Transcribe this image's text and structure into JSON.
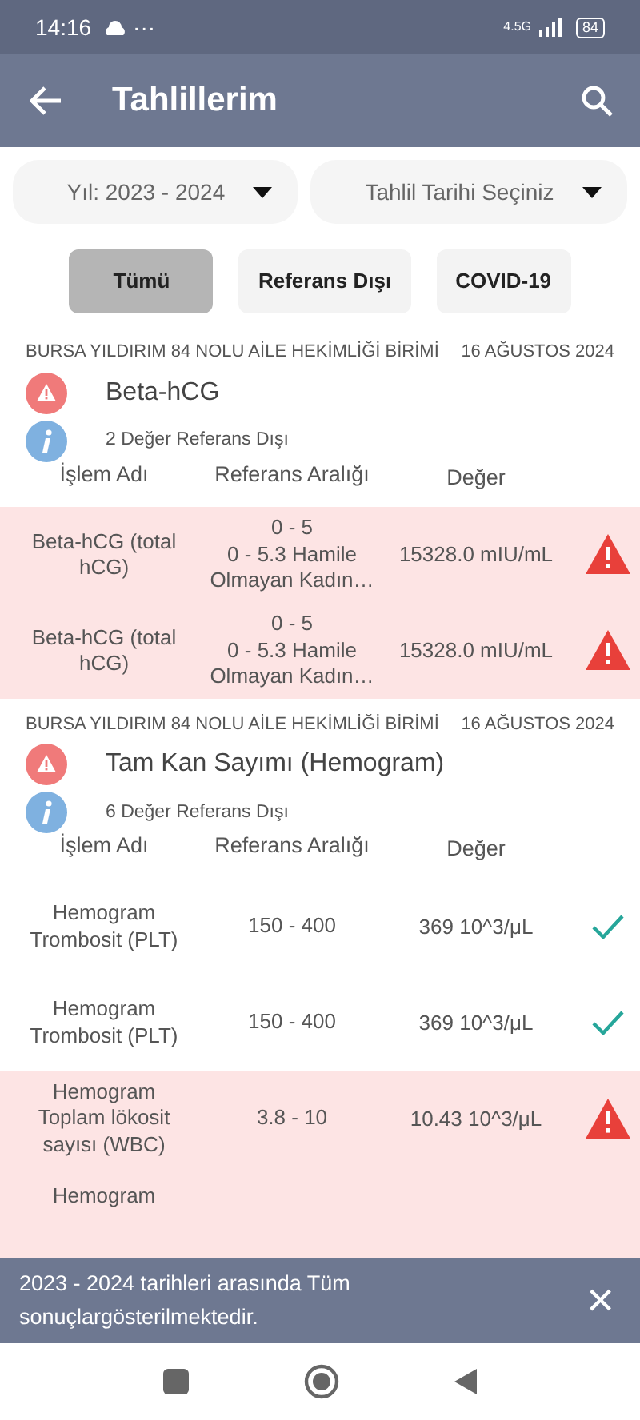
{
  "status_bar": {
    "time": "14:16",
    "dots": "···",
    "network": "4.5G",
    "battery": "84"
  },
  "app_bar": {
    "title": "Tahlillerim"
  },
  "filters": [
    {
      "label": "Yıl: 2023 - 2024"
    },
    {
      "label": "Tahlil Tarihi Seçiniz"
    }
  ],
  "chips": [
    {
      "label": "Tümü",
      "selected": true
    },
    {
      "label": "Referans Dışı",
      "selected": false
    },
    {
      "label": "COVID-19",
      "selected": false
    }
  ],
  "groups": [
    {
      "facility": "BURSA YILDIRIM 84 NOLU AİLE HEKİMLİĞİ BİRİMİ",
      "date": "16 AĞUSTOS 2024",
      "title": "Beta-hCG",
      "summary": "2 Değer Referans Dışı",
      "columns": [
        "İşlem Adı",
        "Referans Aralığı",
        "Değer"
      ],
      "rows": [
        {
          "name": [
            "Beta-hCG (total",
            "hCG)"
          ],
          "reference": [
            "0 - 5",
            "0 - 5.3 Hamile",
            "Olmayan Kadın…"
          ],
          "value": "15328.0 mIU/mL",
          "out_of_range": true
        },
        {
          "name": [
            "Beta-hCG (total",
            "hCG)"
          ],
          "reference": [
            "0 - 5",
            "0 - 5.3 Hamile",
            "Olmayan Kadın…"
          ],
          "value": "15328.0 mIU/mL",
          "out_of_range": true
        }
      ]
    },
    {
      "facility": "BURSA YILDIRIM 84 NOLU AİLE HEKİMLİĞİ BİRİMİ",
      "date": "16 AĞUSTOS 2024",
      "title": "Tam Kan Sayımı (Hemogram)",
      "summary": "6 Değer Referans Dışı",
      "columns": [
        "İşlem Adı",
        "Referans Aralığı",
        "Değer"
      ],
      "rows": [
        {
          "name": [
            "Hemogram",
            "Trombosit (PLT)"
          ],
          "reference": [
            "150 - 400"
          ],
          "value": "369 10^3/μL",
          "out_of_range": false
        },
        {
          "name": [
            "Hemogram",
            "Trombosit (PLT)"
          ],
          "reference": [
            "150 - 400"
          ],
          "value": "369 10^3/μL",
          "out_of_range": false
        },
        {
          "name": [
            "Hemogram",
            "Toplam lökosit",
            "sayısı (WBC)"
          ],
          "reference": [
            "3.8 - 10"
          ],
          "value": "10.43 10^3/μL",
          "out_of_range": true
        },
        {
          "name": [
            "Hemogram"
          ],
          "reference": [],
          "value": "",
          "out_of_range": true
        }
      ]
    }
  ],
  "snackbar": {
    "message": "2023 - 2024 tarihleri arasında Tüm sonuçlargösterilmektedir.",
    "close": "×"
  }
}
